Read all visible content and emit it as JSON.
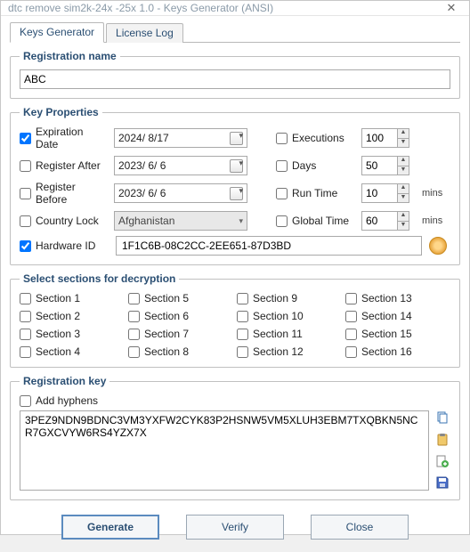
{
  "window": {
    "title": "dtc remove sim2k-24x -25x 1.0 - Keys Generator (ANSI)"
  },
  "tabs": {
    "keys_generator": "Keys Generator",
    "license_log": "License Log"
  },
  "registration_name": {
    "legend": "Registration name",
    "value": "ABC"
  },
  "key_properties": {
    "legend": "Key Properties",
    "expiration_date": {
      "label": "Expiration Date",
      "value": "2024/ 8/17",
      "checked": true
    },
    "register_after": {
      "label": "Register After",
      "value": "2023/ 6/ 6",
      "checked": false
    },
    "register_before": {
      "label": "Register Before",
      "value": "2023/ 6/ 6",
      "checked": false
    },
    "country_lock": {
      "label": "Country Lock",
      "value": "Afghanistan",
      "checked": false
    },
    "hardware_id": {
      "label": "Hardware ID",
      "value": "1F1C6B-08C2CC-2EE651-87D3BD",
      "checked": true
    },
    "executions": {
      "label": "Executions",
      "value": "100",
      "checked": false
    },
    "days": {
      "label": "Days",
      "value": "50",
      "checked": false
    },
    "run_time": {
      "label": "Run Time",
      "value": "10",
      "unit": "mins",
      "checked": false
    },
    "global_time": {
      "label": "Global Time",
      "value": "60",
      "unit": "mins",
      "checked": false
    }
  },
  "sections": {
    "legend": "Select sections for decryption",
    "items": [
      "Section 1",
      "Section 2",
      "Section 3",
      "Section 4",
      "Section 5",
      "Section 6",
      "Section 7",
      "Section 8",
      "Section 9",
      "Section 10",
      "Section 11",
      "Section 12",
      "Section 13",
      "Section 14",
      "Section 15",
      "Section 16"
    ]
  },
  "registration_key": {
    "legend": "Registration key",
    "add_hyphens_label": "Add hyphens",
    "add_hyphens_checked": false,
    "key_text": "3PEZ9NDN9BDNC3VM3YXFW2CYK83P2HSNW5VM5XLUH3EBM7TXQBKN5NCR7GXCVYW6RS4YZX7X"
  },
  "buttons": {
    "generate": "Generate",
    "verify": "Verify",
    "close": "Close"
  }
}
